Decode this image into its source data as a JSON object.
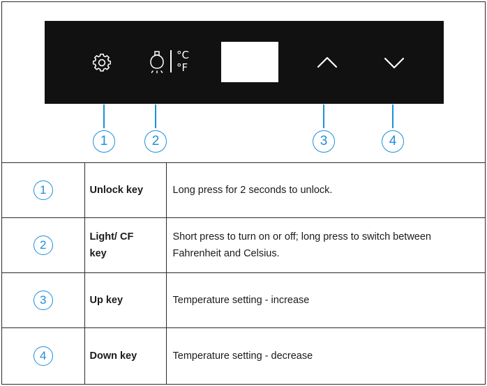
{
  "panel": {
    "display_units": {
      "celsius": "°C",
      "fahrenheit": "°F"
    }
  },
  "callouts": [
    "1",
    "2",
    "3",
    "4"
  ],
  "colors": {
    "accent": "#1d8fd8",
    "panel": "#111111",
    "border": "#2a2a2a"
  },
  "icons": [
    "gear-icon",
    "bulb-icon",
    "chevron-up-icon",
    "chevron-down-icon"
  ],
  "keys": [
    {
      "num": "1",
      "name": "Unlock key",
      "desc": "Long press for 2 seconds to unlock."
    },
    {
      "num": "2",
      "name": "Light/ CF key",
      "desc": "Short press to turn on or off; long press to switch between Fahrenheit and Celsius."
    },
    {
      "num": "3",
      "name": "Up key",
      "desc": "Temperature setting - increase"
    },
    {
      "num": "4",
      "name": "Down key",
      "desc": "Temperature setting - decrease"
    }
  ]
}
